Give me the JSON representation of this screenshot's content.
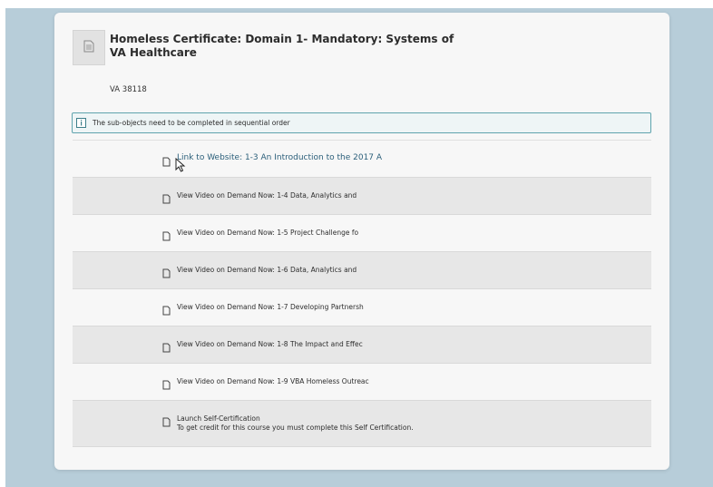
{
  "course": {
    "title": "Homeless Certificate: Domain 1- Mandatory: Systems of VA Healthcare",
    "code": "VA 38118",
    "thumb_icon": "document-icon"
  },
  "notice": {
    "icon": "info-icon",
    "text": "The sub-objects need to be completed in sequential order"
  },
  "items": [
    {
      "label": "Link to Website: 1-3 An Introduction to the 2017 A",
      "icon": "document-icon",
      "style": "link"
    },
    {
      "label": "View Video on Demand Now: 1-4 Data, Analytics and",
      "icon": "document-icon"
    },
    {
      "label": "View Video on Demand Now: 1-5 Project Challenge fo",
      "icon": "document-icon"
    },
    {
      "label": "View Video on Demand Now: 1-6 Data, Analytics and",
      "icon": "document-icon"
    },
    {
      "label": "View Video on Demand Now: 1-7 Developing Partnersh",
      "icon": "document-icon"
    },
    {
      "label": "View Video on Demand Now: 1-8 The Impact and Effec",
      "icon": "document-icon"
    },
    {
      "label": "View Video on Demand Now: 1-9 VBA Homeless Outreac",
      "icon": "document-icon"
    },
    {
      "label": "Launch Self-Certification",
      "description": "To get credit for this course you must complete this Self Certification.",
      "icon": "document-icon"
    }
  ],
  "colors": {
    "backdrop": "#b7cdd9",
    "notice_border": "#5fa3ad",
    "link": "#2b5f7a"
  }
}
